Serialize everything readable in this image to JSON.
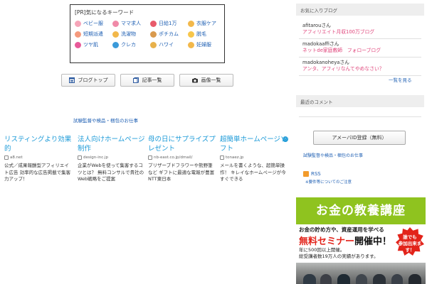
{
  "keywords": {
    "title": "[PR]気になるキーワード",
    "items": [
      {
        "label": "ベビー服",
        "icon": "baby-icon",
        "color": "#f6a5b9"
      },
      {
        "label": "ママ求人",
        "icon": "mom-icon",
        "color": "#f08aa8"
      },
      {
        "label": "日給1万",
        "icon": "bag-icon",
        "color": "#e85a6a"
      },
      {
        "label": "衣服ケア",
        "icon": "shirt-icon",
        "color": "#f2b84b"
      },
      {
        "label": "短期派遣",
        "icon": "person-icon",
        "color": "#f59a7d"
      },
      {
        "label": "洗濯物",
        "icon": "laundry-icon",
        "color": "#f2b84b"
      },
      {
        "label": "ポチカム",
        "icon": "dog-icon",
        "color": "#d99a4e"
      },
      {
        "label": "脱毛",
        "icon": "flower-icon",
        "color": "#f7c64b"
      },
      {
        "label": "ツヤ肌",
        "icon": "heart-icon",
        "color": "#e85a9a"
      },
      {
        "label": "クレカ",
        "icon": "card-icon",
        "color": "#3b9ad9"
      },
      {
        "label": "ハワイ",
        "icon": "rainbow-icon",
        "color": "#e8b14b"
      },
      {
        "label": "妊婦服",
        "icon": "maternity-icon",
        "color": "#f2b84b"
      }
    ]
  },
  "nav": {
    "blog_top": "ブログトップ",
    "articles": "記事一覧",
    "images": "画像一覧"
  },
  "supervision_link": "試験監督や検品・梱包のお仕事",
  "ads": [
    {
      "title": "リスティングより効果的",
      "url": "a8.net",
      "desc": "公式／成果報酬型アフィリエイト広告 効率的な広告掲載で集客力アップ！"
    },
    {
      "title": "法人向けホームページ制作",
      "url": "design-inc.jp",
      "desc": "企業がWebを使って集客するコツとは？ 無料コンサルで貴社のWeb戦略をご提案"
    },
    {
      "title": "母の日にサプライズプレゼント",
      "url": "nb-east.co.jp/dmail/",
      "desc": "プリザーブドフラワーや熊野筆など ギフトに最適な電報が豊富 NTT東日本"
    },
    {
      "title": "超簡単ホームページソフト",
      "url": "tonaez.jp",
      "desc": "メールを書くような、超簡単操作！ キレイなホームページが今すぐできる"
    }
  ],
  "ad_info_icon": "ⓘ",
  "sidebar": {
    "favorites_title": "お気に入りブログ",
    "favorites": [
      {
        "user": "afitarouさん",
        "blog": "アフィリエイト月収100万ブログ"
      },
      {
        "user": "madokaaffiさん",
        "blog": "ネットde家庭教師　フォローブログ"
      },
      {
        "user": "madokanoheyaさん",
        "blog": "アンタ、アフィリなんてやめなさい？"
      }
    ],
    "favorites_more": "一覧を見る",
    "comments_title": "最近のコメント",
    "ameba_button": "アメーバID登録（無料）",
    "supervision_link": "試験監督や検品・梱包のお仕事",
    "rss_label": "RSS",
    "rss_note": "※要件等についてのご注意"
  },
  "banner": {
    "title": "お金の教養講座",
    "subtitle": "お金の貯め方や、資産運用を学べる",
    "main_red": "無料セミナー",
    "main_rest": "開催中！",
    "note_line1": "年に500回以上開催。",
    "note_line2": "総受講者数19万人の実績があります。",
    "star_line1": "誰でも",
    "star_line2": "参加出来ます！",
    "accent": "#8fc31f"
  }
}
